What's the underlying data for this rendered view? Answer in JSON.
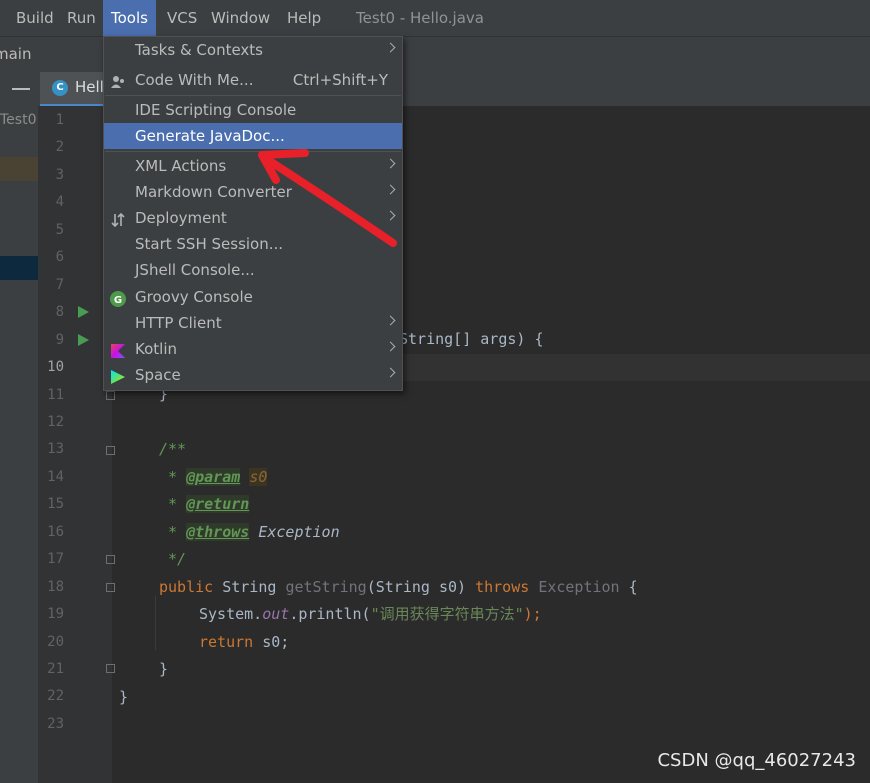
{
  "menubar": {
    "items": [
      "Build",
      "Run",
      "Tools",
      "VCS",
      "Window",
      "Help"
    ],
    "active": "Tools",
    "window_title": "Test0 - Hello.java"
  },
  "toolbar": {
    "breadcrumb": "main"
  },
  "project_panel": {
    "label": "Test0"
  },
  "editor_tab": {
    "label": "Hell"
  },
  "tools_menu": [
    {
      "label": "Tasks & Contexts",
      "submenu": true
    },
    {
      "label": "Code With Me...",
      "shortcut": "Ctrl+Shift+Y",
      "icon": "code-with-me-icon"
    },
    {
      "label": "IDE Scripting Console"
    },
    {
      "label": "Generate JavaDoc...",
      "selected": true
    },
    {
      "label": "XML Actions",
      "submenu": true
    },
    {
      "label": "Markdown Converter",
      "submenu": true
    },
    {
      "label": "Deployment",
      "submenu": true,
      "icon": "deployment-icon"
    },
    {
      "label": "Start SSH Session..."
    },
    {
      "label": "JShell Console..."
    },
    {
      "label": "Groovy Console",
      "icon": "groovy-icon"
    },
    {
      "label": "HTTP Client",
      "submenu": true
    },
    {
      "label": "Kotlin",
      "submenu": true,
      "icon": "kotlin-icon"
    },
    {
      "label": "Space",
      "submenu": true,
      "icon": "space-icon"
    }
  ],
  "line_numbers": [
    "1",
    "2",
    "3",
    "4",
    "5",
    "6",
    "7",
    "8",
    "9",
    "10",
    "11",
    "12",
    "13",
    "14",
    "15",
    "16",
    "17",
    "18",
    "19",
    "20",
    "21",
    "22",
    "23"
  ],
  "current_line": "10",
  "code": {
    "l9_tail": "String[] args) {",
    "l11": "}",
    "l13": "/**",
    "l14_star": " * ",
    "l14_tag": "@param",
    "l14_param": "s0",
    "l15_star": " * ",
    "l15_tag": "@return",
    "l16_star": " * ",
    "l16_tag": "@throws",
    "l16_ex": " Exception",
    "l17": " */",
    "l18_public": "public ",
    "l18_type": "String ",
    "l18_method": "getString",
    "l18_params": "(String s0) ",
    "l18_throws": "throws ",
    "l18_exc": "Exception",
    "l18_brace": " {",
    "l19_sys": "System.",
    "l19_out": "out",
    "l19_print": ".println(",
    "l19_str": "\"调用获得字符串方法\"",
    "l19_end": ");",
    "l20_return": "return ",
    "l20_val": "s0;",
    "l21": "}",
    "l22": "}"
  },
  "watermark": "CSDN @qq_46027243",
  "colors": {
    "selection": "#4b6eaf",
    "annotation_arrow": "#e8202a",
    "background": "#2b2b2b"
  }
}
